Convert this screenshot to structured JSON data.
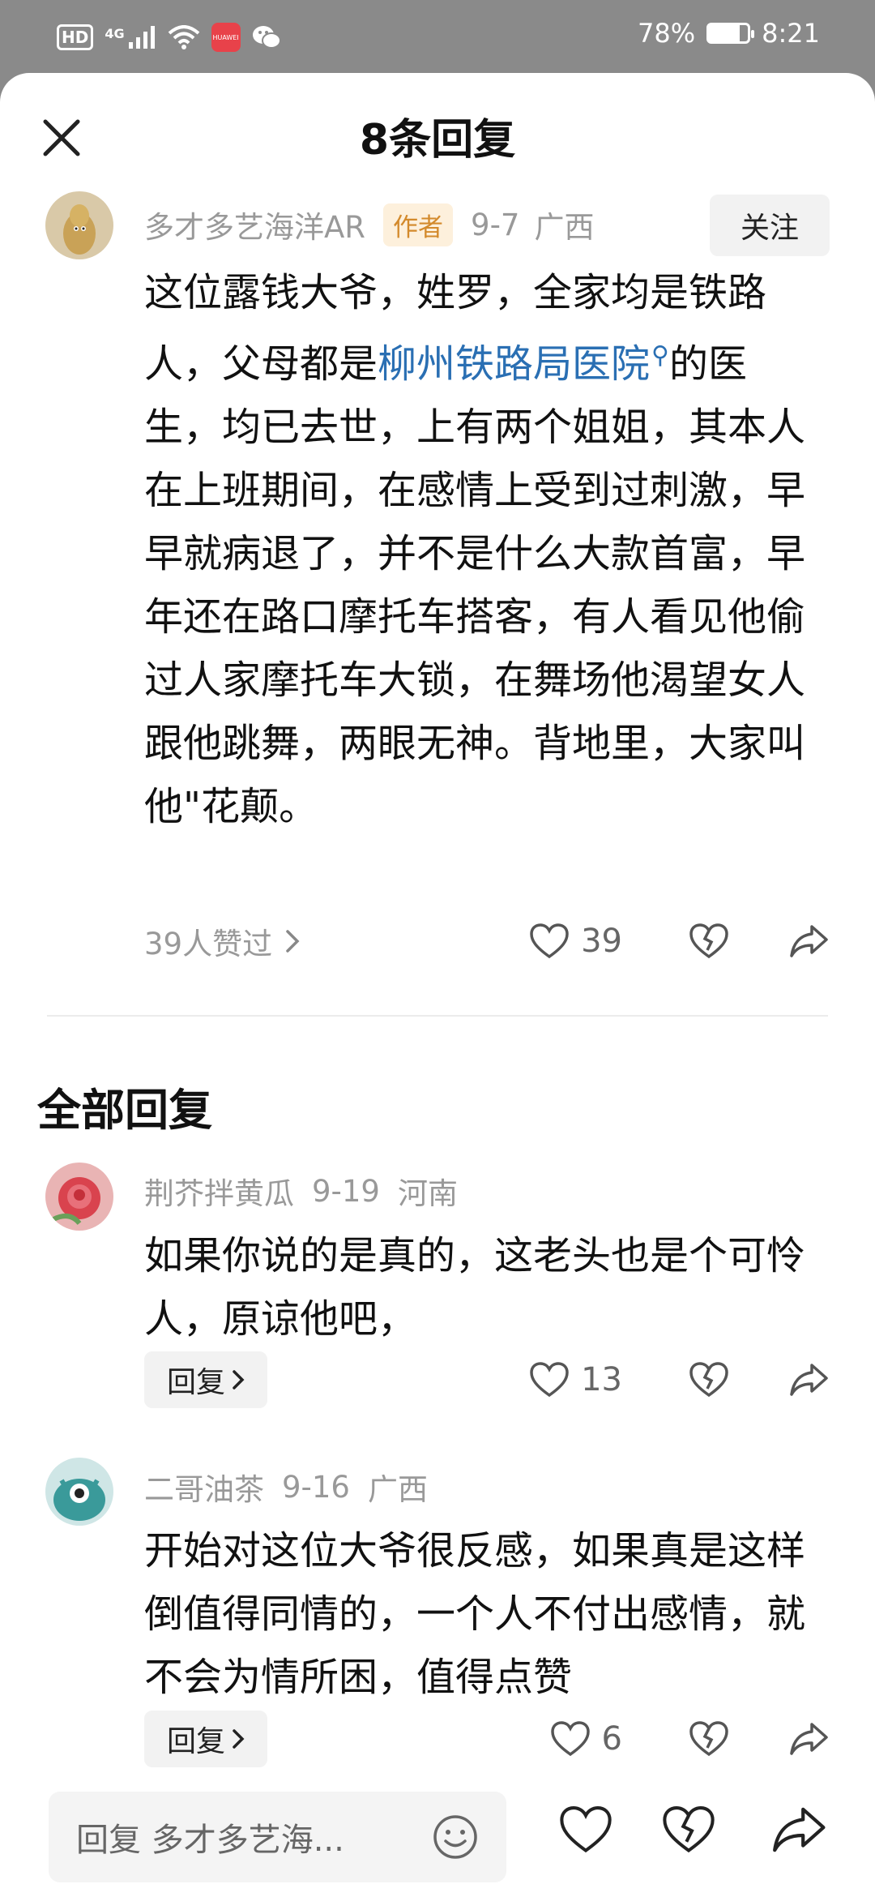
{
  "status_bar": {
    "hd_label": "HD",
    "net_label": "4G",
    "battery_pct": "78%",
    "battery_level": 0.78,
    "time": "8:21",
    "icons": [
      "hd-icon",
      "signal-icon",
      "wifi-icon",
      "huawei-app-icon",
      "wechat-icon",
      "battery-icon"
    ]
  },
  "header": {
    "title": "8条回复",
    "close_icon": "close-icon"
  },
  "main_comment": {
    "author": "多才多艺海洋AR",
    "badge": "作者",
    "date": "9-7",
    "location": "广西",
    "follow_label": "关注",
    "text_before": "这位露钱大爷，姓罗，全家均是铁路人，父母都是",
    "link_text": "柳州铁路局医院",
    "text_after": "的医生，均已去世，上有两个姐姐，其本人在上班期间，在感情上受到过刺激，早早就病退了，并不是什么大款首富，早年还在路口摩托车搭客，有人看见他偷过人家摩托车大锁，在舞场他渴望女人跟他跳舞，两眼无神。背地里，大家叫他\"花颠。",
    "likes_label": "39人赞过",
    "like_count": "39",
    "icons": [
      "heart-icon",
      "broken-heart-icon",
      "share-icon"
    ]
  },
  "replies_section": {
    "title": "全部回复",
    "replies": [
      {
        "author": "荆芥拌黄瓜",
        "date": "9-19",
        "location": "河南",
        "text": "如果你说的是真的，这老头也是个可怜人，原谅他吧，",
        "reply_label": "回复",
        "like_count": "13"
      },
      {
        "author": "二哥油茶",
        "date": "9-16",
        "location": "广西",
        "text": "开始对这位大爷很反感，如果真是这样倒值得同情的，一个人不付出感情，就不会为情所困，值得点赞",
        "reply_label": "回复",
        "like_count": "6"
      }
    ]
  },
  "bottom_bar": {
    "input_placeholder": "回复 多才多艺海...",
    "icons": [
      "emoji-icon",
      "heart-icon",
      "broken-heart-icon",
      "share-icon"
    ]
  },
  "colors": {
    "link": "#2a6fb3",
    "badge_bg": "#fdf0dc",
    "badge_text": "#d38a2c",
    "status_bar_bg": "#8a8a8a"
  }
}
